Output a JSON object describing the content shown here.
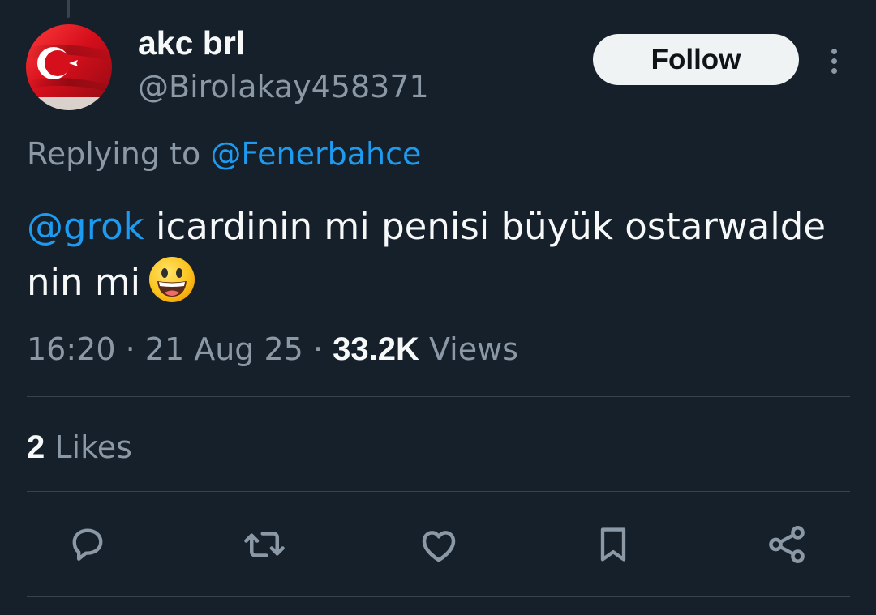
{
  "author": {
    "display_name": "akc brl",
    "handle": "@Birolakay458371",
    "avatar_icon": "turkish-flag-avatar"
  },
  "follow_button": {
    "label": "Follow"
  },
  "more_menu": {
    "icon": "more-vertical-icon"
  },
  "reply_context": {
    "prefix": "Replying to",
    "target": "@Fenerbahce"
  },
  "tweet": {
    "mention": "@grok",
    "text": "icardinin mi penisi büyük ostarwalde nin mi",
    "emoji": "grinning-face-emoji"
  },
  "meta": {
    "time": "16:20",
    "separator": "·",
    "date": "21 Aug 25",
    "views_count": "33.2K",
    "views_label": "Views"
  },
  "stats": {
    "likes_count": "2",
    "likes_label": "Likes"
  },
  "actions": [
    {
      "name": "reply",
      "icon": "reply-icon"
    },
    {
      "name": "retweet",
      "icon": "retweet-icon"
    },
    {
      "name": "like",
      "icon": "heart-icon"
    },
    {
      "name": "bookmark",
      "icon": "bookmark-icon"
    },
    {
      "name": "share",
      "icon": "share-icon"
    }
  ],
  "colors": {
    "background": "#15202b",
    "primary_text": "#f7f9f9",
    "secondary_text": "#8b98a5",
    "accent": "#1d9bf0",
    "divider": "#38444d",
    "flag_red": "#e30a17"
  }
}
